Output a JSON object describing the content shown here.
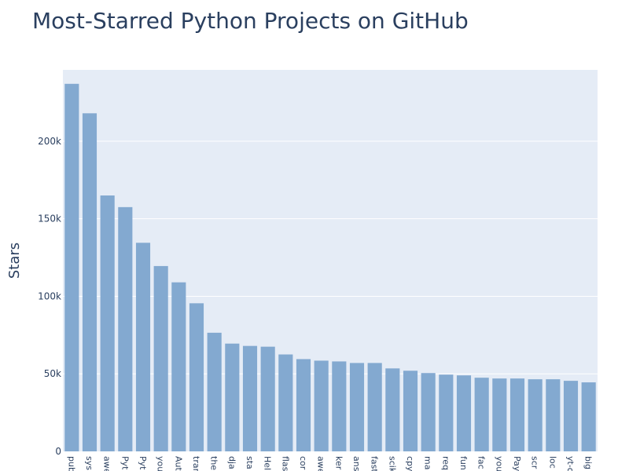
{
  "chart_data": {
    "type": "bar",
    "title": "Most-Starred Python Projects on GitHub",
    "xlabel": "",
    "ylabel": "Stars",
    "ylim": [
      0,
      246000
    ],
    "yticks": [
      {
        "value": 0,
        "label": "0"
      },
      {
        "value": 50000,
        "label": "50k"
      },
      {
        "value": 100000,
        "label": "100k"
      },
      {
        "value": 150000,
        "label": "150k"
      },
      {
        "value": 200000,
        "label": "200k"
      }
    ],
    "categories": [
      "pub",
      "sys",
      "awe",
      "Pyt",
      "Pyt",
      "you",
      "Aut",
      "tran",
      "the",
      "dja",
      "sta",
      "Hel",
      "flas",
      "cor",
      "awe",
      "ker",
      "ans",
      "fast",
      "scik",
      "cpy",
      "ma",
      "req",
      "fun",
      "fac",
      "you",
      "Pay",
      "scr",
      "loc",
      "yt-d",
      "big"
    ],
    "values": [
      237000,
      218000,
      165000,
      157500,
      134500,
      119500,
      109000,
      95500,
      76500,
      69500,
      68000,
      67500,
      62500,
      59500,
      58500,
      58000,
      57000,
      57000,
      53500,
      52000,
      50500,
      49500,
      49000,
      47500,
      47000,
      47000,
      46500,
      46500,
      45500,
      44500
    ],
    "bar_color": "#83a9d0",
    "plot_bg": "#e5ecf6",
    "grid": true
  }
}
